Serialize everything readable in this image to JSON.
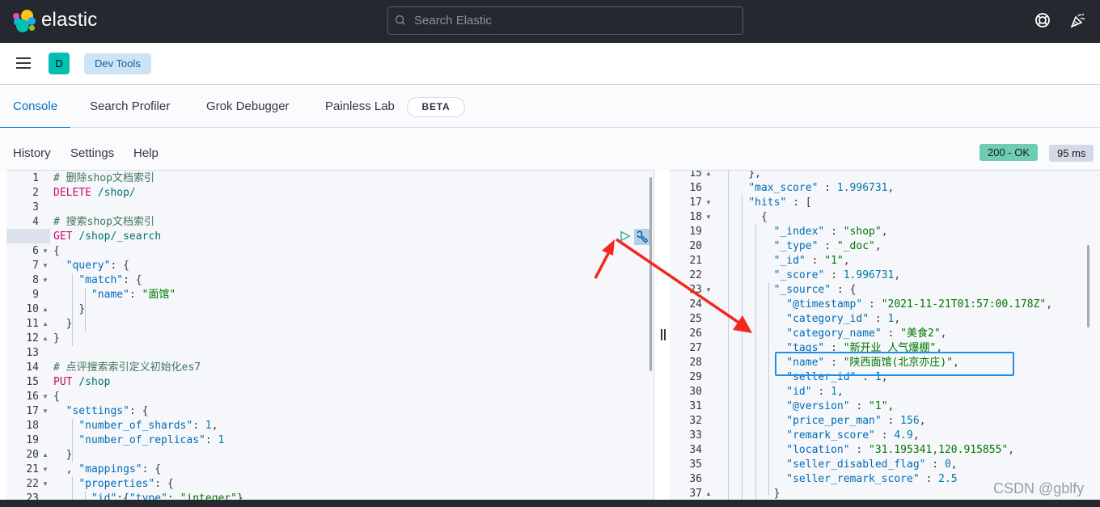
{
  "header": {
    "brand": "elastic",
    "search_placeholder": "Search Elastic",
    "icons": [
      "help-lifebuoy-icon",
      "newsfeed-party-icon"
    ]
  },
  "breadcrumb": {
    "avatar_letter": "D",
    "current": "Dev Tools"
  },
  "tabs": [
    {
      "label": "Console",
      "active": true
    },
    {
      "label": "Search Profiler",
      "active": false
    },
    {
      "label": "Grok Debugger",
      "active": false
    },
    {
      "label": "Painless Lab",
      "active": false,
      "badge": "BETA"
    }
  ],
  "toolbar": {
    "history": "History",
    "settings": "Settings",
    "help": "Help",
    "status": "200 - OK",
    "timing": "95 ms"
  },
  "colors": {
    "topbar": "#25282f",
    "accent": "#0071c2",
    "status_ok": "#6dccb1",
    "method": "#c80a68",
    "string_value": "#007700",
    "annotation_red": "#f02a1d",
    "annotation_blue": "#1e8fe8"
  },
  "editor": {
    "lines": [
      {
        "n": "1",
        "fold": "",
        "text": "# 删除shop文档索引"
      },
      {
        "n": "2",
        "fold": "",
        "text": "DELETE /shop/"
      },
      {
        "n": "3",
        "fold": "",
        "text": ""
      },
      {
        "n": "4",
        "fold": "",
        "text": "# 搜索shop文档索引"
      },
      {
        "n": "5",
        "fold": "",
        "text": "GET /shop/_search"
      },
      {
        "n": "6",
        "fold": "down",
        "text": "{"
      },
      {
        "n": "7",
        "fold": "down",
        "text": "  \"query\": {"
      },
      {
        "n": "8",
        "fold": "down",
        "text": "    \"match\": {"
      },
      {
        "n": "9",
        "fold": "",
        "text": "      \"name\": \"面馆\""
      },
      {
        "n": "10",
        "fold": "up",
        "text": "    }"
      },
      {
        "n": "11",
        "fold": "up",
        "text": "  }"
      },
      {
        "n": "12",
        "fold": "up",
        "text": "}"
      },
      {
        "n": "13",
        "fold": "",
        "text": ""
      },
      {
        "n": "14",
        "fold": "",
        "text": "# 点评搜索索引定义初始化es7"
      },
      {
        "n": "15",
        "fold": "",
        "text": "PUT /shop"
      },
      {
        "n": "16",
        "fold": "down",
        "text": "{"
      },
      {
        "n": "17",
        "fold": "down",
        "text": "  \"settings\": {"
      },
      {
        "n": "18",
        "fold": "",
        "text": "    \"number_of_shards\": 1,"
      },
      {
        "n": "19",
        "fold": "",
        "text": "    \"number_of_replicas\": 1"
      },
      {
        "n": "20",
        "fold": "up",
        "text": "  }"
      },
      {
        "n": "21",
        "fold": "down",
        "text": "  , \"mappings\": {"
      },
      {
        "n": "22",
        "fold": "down",
        "text": "    \"properties\": {"
      },
      {
        "n": "23",
        "fold": "",
        "text": "      \"id\":{\"type\": \"integer\"},"
      }
    ],
    "run_button": "play-icon",
    "settings_button": "wrench-icon"
  },
  "output": {
    "lines": [
      {
        "n": "15",
        "fold": "up",
        "text": "    },"
      },
      {
        "n": "16",
        "fold": "",
        "text": "    \"max_score\" : 1.996731,"
      },
      {
        "n": "17",
        "fold": "down",
        "text": "    \"hits\" : ["
      },
      {
        "n": "18",
        "fold": "down",
        "text": "      {"
      },
      {
        "n": "19",
        "fold": "",
        "text": "        \"_index\" : \"shop\","
      },
      {
        "n": "20",
        "fold": "",
        "text": "        \"_type\" : \"_doc\","
      },
      {
        "n": "21",
        "fold": "",
        "text": "        \"_id\" : \"1\","
      },
      {
        "n": "22",
        "fold": "",
        "text": "        \"_score\" : 1.996731,"
      },
      {
        "n": "23",
        "fold": "down",
        "text": "        \"_source\" : {"
      },
      {
        "n": "24",
        "fold": "",
        "text": "          \"@timestamp\" : \"2021-11-21T01:57:00.178Z\","
      },
      {
        "n": "25",
        "fold": "",
        "text": "          \"category_id\" : 1,"
      },
      {
        "n": "26",
        "fold": "",
        "text": "          \"category_name\" : \"美食2\","
      },
      {
        "n": "27",
        "fold": "",
        "text": "          \"tags\" : \"新开业 人气爆棚\","
      },
      {
        "n": "28",
        "fold": "",
        "text": "          \"name\" : \"陕西面馆(北京亦庄)\","
      },
      {
        "n": "29",
        "fold": "",
        "text": "          \"seller_id\" : 1,"
      },
      {
        "n": "30",
        "fold": "",
        "text": "          \"id\" : 1,"
      },
      {
        "n": "31",
        "fold": "",
        "text": "          \"@version\" : \"1\","
      },
      {
        "n": "32",
        "fold": "",
        "text": "          \"price_per_man\" : 156,"
      },
      {
        "n": "33",
        "fold": "",
        "text": "          \"remark_score\" : 4.9,"
      },
      {
        "n": "34",
        "fold": "",
        "text": "          \"location\" : \"31.195341,120.915855\","
      },
      {
        "n": "35",
        "fold": "",
        "text": "          \"seller_disabled_flag\" : 0,"
      },
      {
        "n": "36",
        "fold": "",
        "text": "          \"seller_remark_score\" : 2.5"
      },
      {
        "n": "37",
        "fold": "up",
        "text": "        }"
      }
    ]
  },
  "watermark": "CSDN @gblfy"
}
